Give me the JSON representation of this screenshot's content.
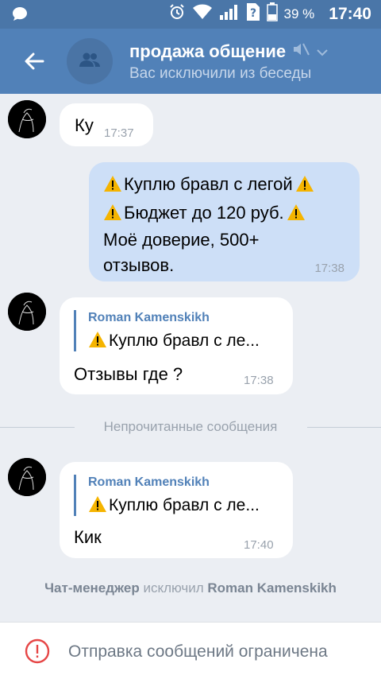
{
  "status_bar": {
    "battery_percent": "39 %",
    "time": "17:40",
    "icons": [
      "chat-notification-icon",
      "alarm-icon",
      "wifi-icon",
      "signal-icon",
      "no-sim-icon",
      "battery-icon"
    ]
  },
  "header": {
    "title": "продажа общение",
    "subtitle": "Вас исключили из беседы",
    "icons": [
      "back-arrow-icon",
      "group-icon",
      "muted-icon",
      "chevron-down-icon"
    ]
  },
  "messages": [
    {
      "direction": "in",
      "text": "Ку",
      "time": "17:37"
    },
    {
      "direction": "out",
      "lines": [
        "Куплю бравл с легой",
        "Бюджет до 120 руб.",
        "Моё доверие, 500+",
        "отзывов."
      ],
      "time": "17:38"
    },
    {
      "direction": "in",
      "reply_author": "Roman Kamenskikh",
      "reply_text": "Куплю бравл с ле...",
      "text": "Отзывы где ?",
      "time": "17:38"
    },
    {
      "direction": "in",
      "reply_author": "Roman Kamenskikh",
      "reply_text": "Куплю бравл с ле...",
      "text": "Кик",
      "time": "17:40"
    }
  ],
  "unread_divider": "Непрочитанные сообщения",
  "service_message": {
    "actor": "Чат-менеджер",
    "action": "исключил",
    "target": "Roman Kamenskikh"
  },
  "bottom_bar": {
    "text": "Отправка сообщений ограничена",
    "icon": "alert-circle-icon"
  },
  "colors": {
    "status_bar": "#4a76a8",
    "header": "#5181b8",
    "background": "#ebeef3",
    "outgoing_bubble": "#cddff7",
    "alert": "#e64646"
  }
}
